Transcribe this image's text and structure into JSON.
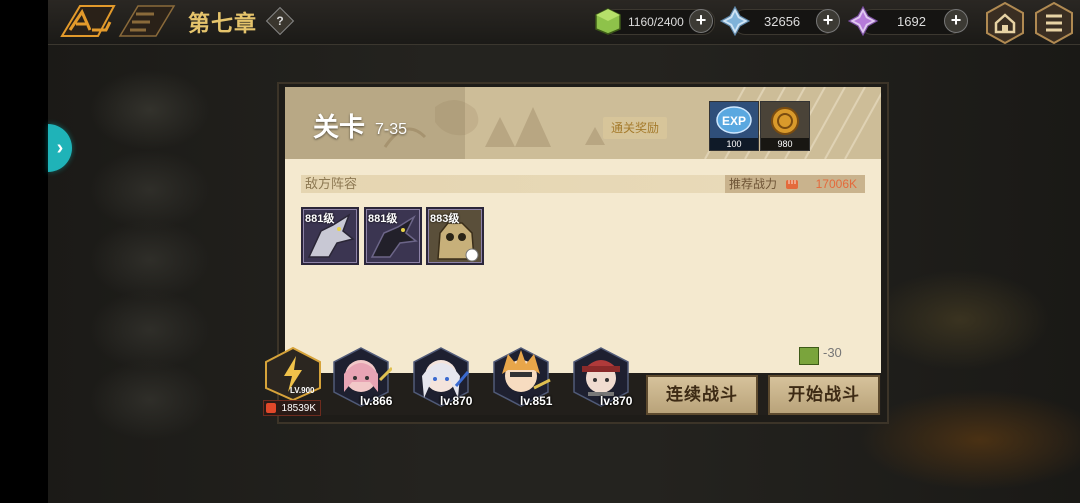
{
  "topbar": {
    "chapter_title": "第七章",
    "help_symbol": "?",
    "stamina": "1160/2400",
    "crystal": "32656",
    "gem": "1692",
    "plus": "+"
  },
  "side_arrow": "›",
  "stage": {
    "label": "关卡",
    "number": "7-35",
    "reward_label": "通关奖励",
    "rewards": [
      {
        "name": "EXP",
        "value": "100"
      },
      {
        "name": "coin",
        "value": "980"
      }
    ]
  },
  "enemy_section": {
    "label": "敌方阵容",
    "recommended_power_label": "推荐战力",
    "recommended_power": "17006K",
    "enemies": [
      {
        "level": "881级"
      },
      {
        "level": "881级"
      },
      {
        "level": "883级"
      }
    ]
  },
  "cost": "-30",
  "team": {
    "boss_level": "LV.900",
    "boss_power": "18539K",
    "heroes": [
      {
        "level": "lv.866"
      },
      {
        "level": "lv.870"
      },
      {
        "level": "lv.851"
      },
      {
        "level": "lv.870"
      }
    ]
  },
  "buttons": {
    "continuous_battle": "连续战斗",
    "start_battle": "开始战斗"
  },
  "colors": {
    "accent_gold": "#e5c46c",
    "panel_bg": "#f4e9cf",
    "power_value": "#e46a3c",
    "side_arrow": "#1fb3b8"
  }
}
